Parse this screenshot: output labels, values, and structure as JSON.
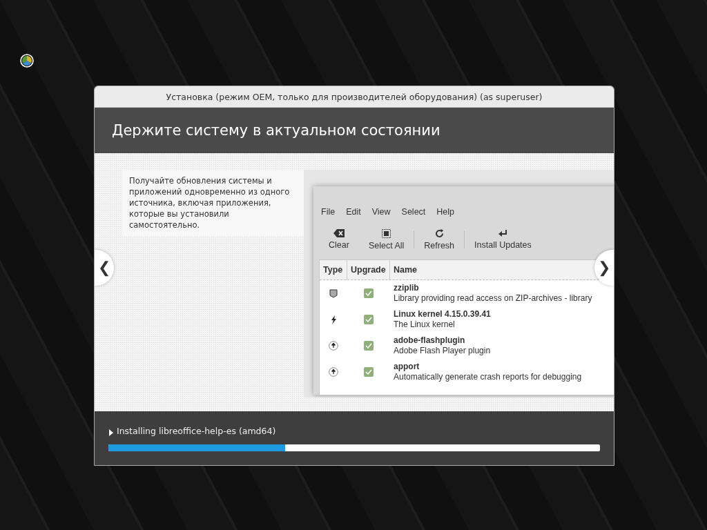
{
  "window": {
    "title": "Установка (режим OEM, только для производителей оборудования) (as superuser)",
    "heading": "Держите систему в актуальном состоянии",
    "description": "Получайте обновления системы и приложений одновременно из одного источника, включая приложения, которые вы установили самостоятельно.",
    "prev_button": "❮",
    "next_button": "❯",
    "app_screenshot": {
      "menu": [
        "File",
        "Edit",
        "View",
        "Select",
        "Help"
      ],
      "toolbar": [
        {
          "label": "Clear",
          "kind": "clear"
        },
        {
          "label": "Select All",
          "kind": "select"
        },
        {
          "label": "Refresh",
          "kind": "refresh"
        },
        {
          "label": "Install Updates",
          "kind": "install"
        }
      ],
      "table": {
        "columns": [
          "Type",
          "Upgrade",
          "Name"
        ],
        "rows": [
          {
            "kind": "security",
            "upgrade": true,
            "name": "zziplib",
            "description": "Library providing read access on ZIP-archives - library"
          },
          {
            "kind": "kernel",
            "upgrade": true,
            "name": "Linux kernel 4.15.0.39.41",
            "description": "The Linux kernel"
          },
          {
            "kind": "package",
            "upgrade": true,
            "name": "adobe-flashplugin",
            "description": "Adobe Flash Player plugin"
          },
          {
            "kind": "package",
            "upgrade": true,
            "name": "apport",
            "description": "Automatically generate crash reports for debugging"
          }
        ]
      }
    },
    "status": "Installing libreoffice-help-es (amd64)",
    "progress": {
      "level": 0.36
    }
  }
}
